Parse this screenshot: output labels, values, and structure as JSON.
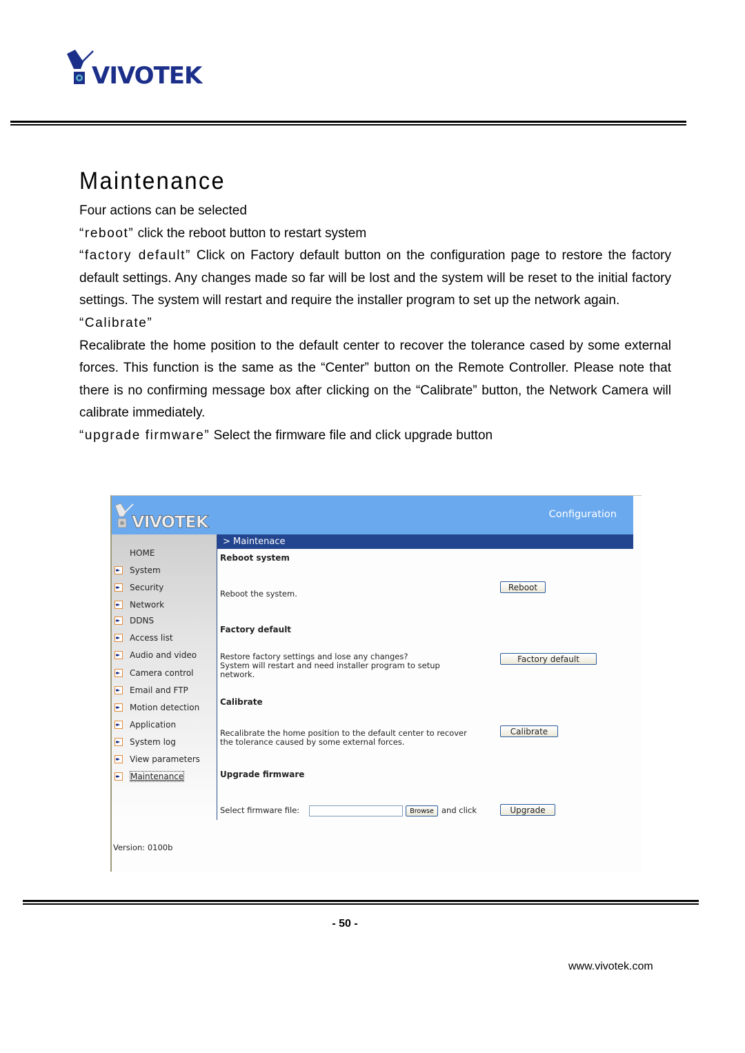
{
  "brand": {
    "name": "VIVOTEK",
    "logo_color": "#1b2f8a",
    "accent_color": "#6aa9ee"
  },
  "page": {
    "title": "Maintenance",
    "paragraphs": [
      {
        "lead": "",
        "text": "Four actions can be selected"
      },
      {
        "lead": "“reboot”",
        "text": " click the reboot button to restart system"
      },
      {
        "lead": "“factory default”",
        "text": " Click on Factory default button on the configuration page to restore the factory default settings. Any changes made so far will be lost and the system will be reset to the initial factory settings. The system will restart and require the installer program to set up the network again."
      },
      {
        "lead": "“Calibrate”",
        "text": ""
      },
      {
        "lead": "",
        "text": "Recalibrate the home position to the default center to recover the tolerance cased by some external forces. This function is the same as the “Center” button on the Remote Controller. Please note that there is no confirming message box after clicking on the “Calibrate” button, the Network Camera will calibrate immediately."
      },
      {
        "lead": "“upgrade firmware”",
        "text": " Select the firmware file and click upgrade button"
      }
    ],
    "page_number": "- 50 -",
    "website": "www.vivotek.com"
  },
  "screenshot": {
    "header_label": "Configuration",
    "breadcrumb": "> Maintenace",
    "sidebar": {
      "home": "HOME",
      "items": [
        "System",
        "Security",
        "Network",
        "DDNS",
        "Access list",
        "Audio and video",
        "Camera control",
        "Email and FTP",
        "Motion detection",
        "Application",
        "System log",
        "View parameters",
        "Maintenance"
      ],
      "active": "Maintenance",
      "version": "Version: 0100b"
    },
    "sections": {
      "reboot": {
        "heading": "Reboot system",
        "desc": "Reboot the system.",
        "button": "Reboot"
      },
      "factory": {
        "heading": "Factory default",
        "desc_1": "Restore factory settings and lose any changes?",
        "desc_2": "System will restart and need installer program to setup",
        "desc_3": "network.",
        "button": "Factory default"
      },
      "calibrate": {
        "heading": "Calibrate",
        "desc_1": "Recalibrate the home position to the default center to recover",
        "desc_2": "the tolerance caused by some external forces.",
        "button": "Calibrate"
      },
      "upgrade": {
        "heading": "Upgrade firmware",
        "file_label": "Select firmware file:",
        "file_value": "",
        "browse": "Browse",
        "and_click": "and click",
        "button": "Upgrade"
      }
    }
  }
}
